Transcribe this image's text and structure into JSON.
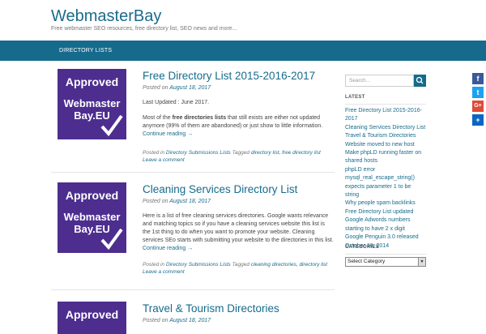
{
  "site": {
    "title": "WebmasterBay",
    "description": "Free webmaster SEO resources, free directory list, SEO news and more..."
  },
  "nav": {
    "item": "DIRECTORY LISTS"
  },
  "thumbnail": {
    "approved": "Approved",
    "brand_line1": "Webmaster",
    "brand_line2": "Bay.EU"
  },
  "posts": [
    {
      "title": "Free Directory List 2015-2016-2017",
      "posted_on": "Posted on",
      "date": "August 18, 2017",
      "p1": "Last Updated : June 2017.",
      "p2_pre": "Most of the ",
      "p2_bold": "free directories lists",
      "p2_post": " that still exists are either not updated anymore (99% of them are abandoned) or just show to little information.",
      "continue": "Continue reading →",
      "posted_in": "Posted in",
      "category": "Directory Submissions Lists",
      "tagged": "Tagged",
      "tags": "directory list, free directory list",
      "comment": "Leave a comment"
    },
    {
      "title": "Cleaning Services Directory List",
      "posted_on": "Posted on",
      "date": "August 18, 2017",
      "p1": "Here is a list of free cleaning services directories. Google wants relevance and matching topics so if you have a cleaning services website this list is the 1st thing to do when you want to promote your website. Cleaning services SEo starts with submitting your website to the directories in this list.",
      "continue": "Continue reading →",
      "posted_in": "Posted in",
      "category": "Directory Submissions Lists",
      "tagged": "Tagged",
      "tags": "cleaning directories, directory list",
      "comment": "Leave a comment"
    },
    {
      "title": "Travel & Tourism Directories",
      "posted_on": "Posted on",
      "date": "August 18, 2017"
    }
  ],
  "sidebar": {
    "search_placeholder": "Search...",
    "latest_title": "LATEST",
    "latest": [
      "Free Directory List 2015-2016-2017",
      "Cleaning Services Directory List",
      "Travel & Tourism Directories",
      "Website moved to new host",
      "Make phpLD running faster on shared hosts",
      "phpLD error mysql_real_escape_string() expects parameter 1 to be string",
      "Why people spam backlinks",
      "Free Directory List updated",
      "Google Adwords numbers starting to have 2 x digit",
      "Google Penguin 3.0 released October 18, 2014"
    ],
    "categories_title": "CATEGORIES",
    "category_select": "Select Category"
  },
  "share": {
    "facebook": {
      "glyph": "f",
      "color": "#3b5998"
    },
    "twitter": {
      "glyph": "t",
      "color": "#1da1f2"
    },
    "google": {
      "glyph": "G+",
      "color": "#dd4b39"
    },
    "more": {
      "glyph": "+",
      "color": "#0a66c2"
    }
  }
}
